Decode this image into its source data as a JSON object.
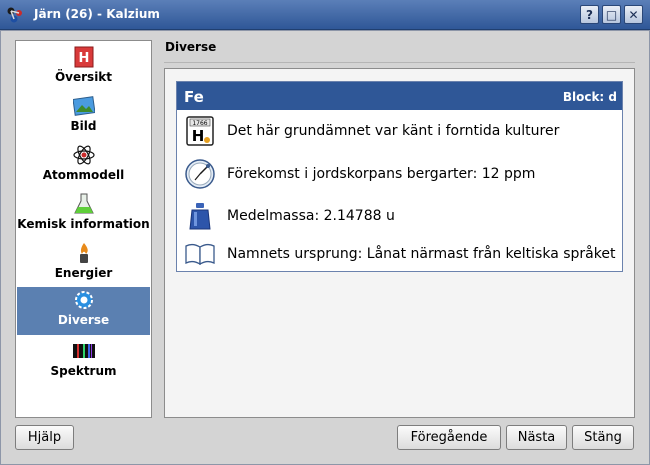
{
  "window": {
    "title": "Järn (26) - Kalzium",
    "controls": {
      "help": "?",
      "minimize": "□",
      "close": "✕"
    }
  },
  "sidebar": {
    "items": [
      {
        "label": "Översikt",
        "icon": "element-h-icon"
      },
      {
        "label": "Bild",
        "icon": "picture-icon"
      },
      {
        "label": "Atommodell",
        "icon": "atom-icon"
      },
      {
        "label": "Kemisk information",
        "icon": "flask-icon"
      },
      {
        "label": "Energier",
        "icon": "flame-icon"
      },
      {
        "label": "Diverse",
        "icon": "gear-icon",
        "active": true
      },
      {
        "label": "Spektrum",
        "icon": "spectrum-icon"
      }
    ]
  },
  "main": {
    "section_title": "Diverse",
    "card": {
      "symbol": "Fe",
      "block": "Block: d",
      "rows": [
        {
          "icon": "discovery-icon",
          "text": "Det här grundämnet var känt i forntida kulturer",
          "badge": "1766",
          "badge_letter": "H"
        },
        {
          "icon": "clock-icon",
          "text": "Förekomst i jordskorpans bergarter: 12 ppm"
        },
        {
          "icon": "weight-icon",
          "text": "Medelmassa: 2.14788 u"
        },
        {
          "icon": "book-icon",
          "text": "Namnets ursprung: Lånat närmast från keltiska språket"
        }
      ]
    }
  },
  "buttons": {
    "help": "Hjälp",
    "previous": "Föregående",
    "next": "Nästa",
    "close": "Stäng"
  },
  "colors": {
    "titlebar": "#2f5797",
    "selection": "#5b80b1",
    "card_header": "#2f5797"
  }
}
